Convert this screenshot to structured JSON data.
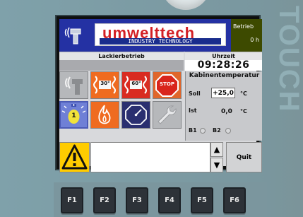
{
  "panel_label": "TOUCH",
  "header": {
    "brand": "umwelttech",
    "brand_sub": "INDUSTRY TECHNOLOGY",
    "status_label": "Betrieb",
    "status_hours": "0 h"
  },
  "mode_bar": {
    "label": "Lackierbetrieb"
  },
  "time_bar": {
    "label": "Uhrzeit",
    "time": "09:28:26"
  },
  "tiles": [
    {
      "name": "spray-gun-tile",
      "label": ""
    },
    {
      "name": "heat-30-tile",
      "label": "30°"
    },
    {
      "name": "heat-60-tile",
      "label": "60°"
    },
    {
      "name": "stop-tile",
      "label": "STOP"
    },
    {
      "name": "lamp-tile",
      "label": "1"
    },
    {
      "name": "burner-tile",
      "label": ""
    },
    {
      "name": "timer-tile",
      "label": ""
    },
    {
      "name": "maintenance-tile",
      "label": ""
    }
  ],
  "cabin": {
    "title": "Kabinentemperatur",
    "soll_label": "Soll",
    "soll_value": "+25,0",
    "soll_unit": "°C",
    "ist_label": "Ist",
    "ist_value": "0,0",
    "ist_unit": "°C",
    "b1_label": "B1",
    "b2_label": "B2"
  },
  "footer": {
    "quit_label": "Quit",
    "up_arrow": "▲",
    "down_arrow": "▼"
  },
  "function_keys": [
    "F1",
    "F2",
    "F3",
    "F4",
    "F5",
    "F6"
  ],
  "colors": {
    "header_blue": "#2431a3",
    "status_olive": "#3d4a00",
    "brand_red": "#d31f25",
    "warning_yellow": "#ffcc00"
  }
}
